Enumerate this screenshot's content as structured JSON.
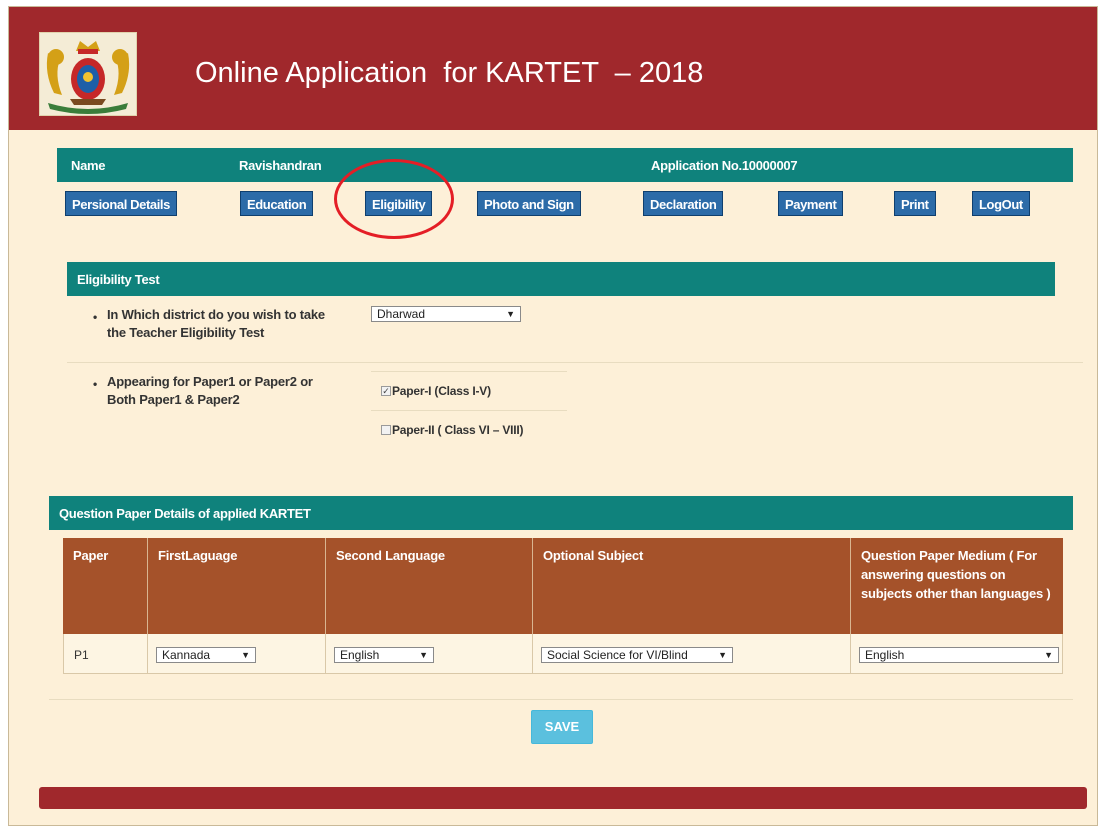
{
  "header": {
    "title": "Online Application  for KARTET  – 2018",
    "emblem_icon": "karnataka-emblem-icon"
  },
  "info_bar": {
    "name_label": "Name",
    "name_value": "Ravishandran",
    "application_no": "Application No.10000007"
  },
  "nav": {
    "items": [
      "Persional Details",
      "Education",
      "Eligibility",
      "Photo and Sign",
      "Declaration",
      "Payment",
      "Print",
      "LogOut"
    ],
    "highlighted": "Eligibility"
  },
  "eligibility": {
    "section_title": "Eligibility Test",
    "district_question": [
      "In Which district do you wish to take",
      "the Teacher Eligibility Test"
    ],
    "district_selected": "Dharwad",
    "paper_question": [
      "Appearing for Paper1 or Paper2 or",
      "Both Paper1 & Paper2"
    ],
    "paper1_label": "Paper-I (Class I-V)",
    "paper1_checked": true,
    "paper2_label": "Paper-II ( Class VI – VIII)",
    "paper2_checked": false
  },
  "question_paper": {
    "section_title": "Question Paper Details of applied KARTET",
    "headers": [
      "Paper",
      "FirstLaguage",
      "Second Language",
      "Optional Subject",
      "Question Paper Medium ( For answering questions on subjects other than languages )"
    ],
    "row": {
      "paper": "P1",
      "first_language": "Kannada",
      "second_language": "English",
      "optional_subject": "Social Science for VI/Blind",
      "medium": "English"
    }
  },
  "save_label": "SAVE",
  "colors": {
    "maroon": "#a0282c",
    "teal": "#0f827c",
    "brown": "#a5522a",
    "nav_blue": "#2c6ba8",
    "page_bg": "#fdf0d8",
    "save": "#5bc0de"
  }
}
